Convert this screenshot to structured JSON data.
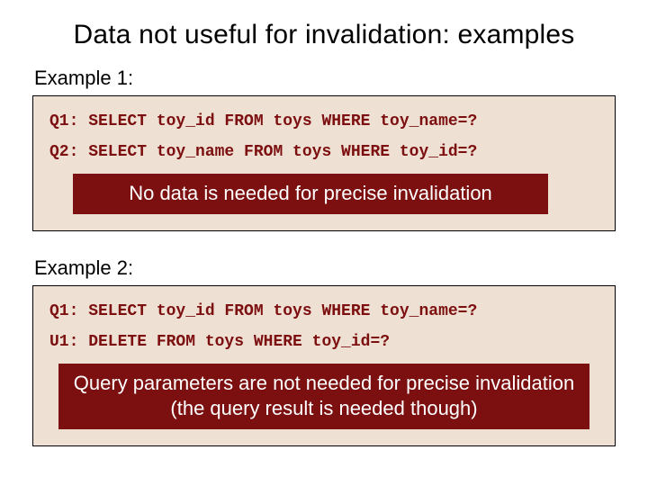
{
  "title": "Data not useful for invalidation: examples",
  "example1": {
    "label": "Example 1:",
    "q1": "Q1: SELECT toy_id FROM toys WHERE toy_name=?",
    "q2": "Q2: SELECT toy_name FROM toys WHERE toy_id=?",
    "callout": "No data is needed for precise invalidation"
  },
  "example2": {
    "label": "Example 2:",
    "q1": "Q1: SELECT toy_id FROM toys WHERE toy_name=?",
    "u1": "U1: DELETE FROM toys WHERE toy_id=?",
    "callout": "Query parameters are not needed for precise invalidation\n(the query result is needed though)"
  }
}
